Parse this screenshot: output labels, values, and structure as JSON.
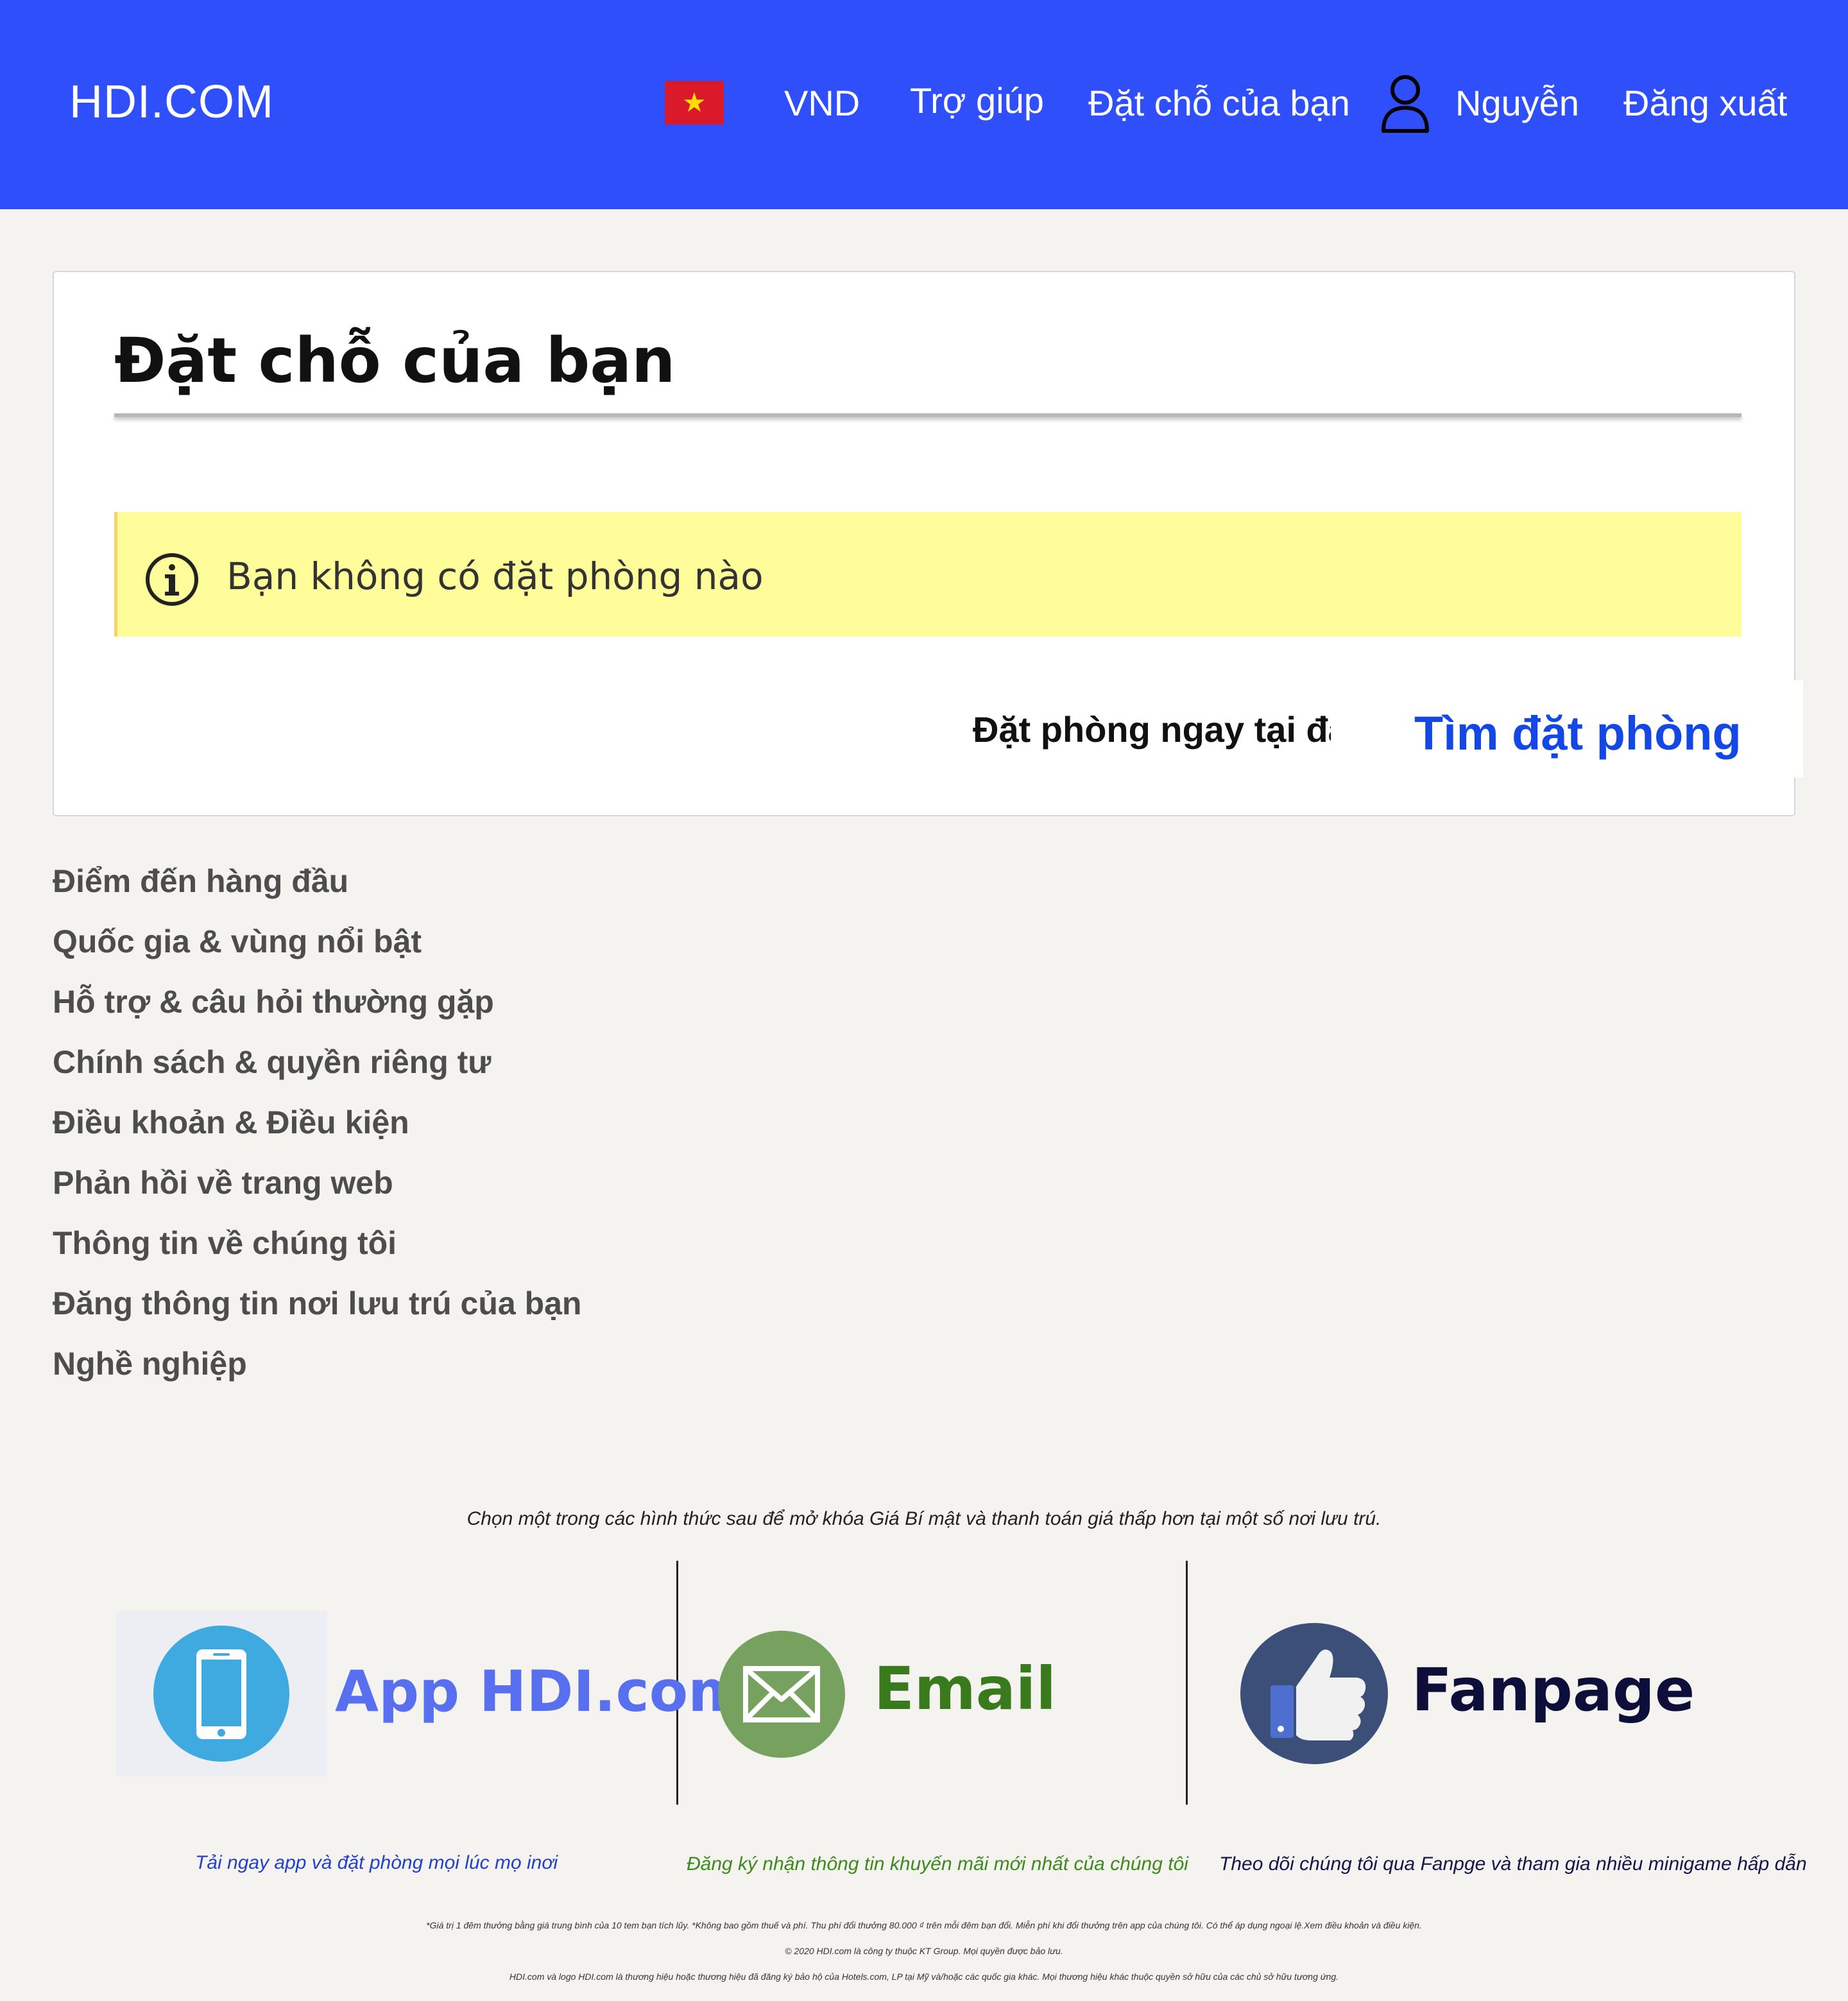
{
  "header": {
    "brand": "HDI.COM",
    "currency": "VND",
    "help": "Trợ giúp",
    "bookings": "Đặt chỗ của bạn",
    "user_name": "Nguyễn",
    "logout": "Đăng xuất"
  },
  "main": {
    "title": "Đặt chỗ của bạn",
    "alert": "Bạn không có đặt phòng nào",
    "book_now_label": "Đặt phòng ngay tại đây",
    "find_button": "Tìm đặt phòng"
  },
  "footer_links": [
    "Điểm đến hàng đầu",
    "Quốc gia & vùng nổi bật",
    "Hỗ trợ & câu hỏi thường gặp",
    "Chính sách & quyền riêng tư",
    "Điều khoản & Điều kiện",
    "Phản hồi về trang web",
    "Thông tin về chúng tôi",
    "Đăng thông tin nơi lưu trú của bạn",
    "Nghề nghiệp"
  ],
  "promo": {
    "intro": "Chọn một trong các hình thức sau để mở khóa Giá Bí mật và thanh toán giá thấp hơn tại một số nơi lưu trú.",
    "app": {
      "title": "App HDI.com",
      "desc": "Tải ngay app và đặt phòng mọi lúc mọ inơi",
      "icon": "phone-icon",
      "color": "#5870ef"
    },
    "email": {
      "title": "Email",
      "desc": "Đăng ký nhận thông tin khuyến mãi mới nhất của chúng tôi",
      "icon": "envelope-icon",
      "color": "#387a1c"
    },
    "fanpage": {
      "title": "Fanpage",
      "desc": "Theo dõi chúng tôi qua Fanpge và tham gia nhiều minigame hấp dẫn",
      "icon": "thumbs-up-icon",
      "color": "#0d0f3a"
    }
  },
  "fine_print": [
    "*Giá trị 1 đêm thưởng bằng giá trung bình của 10 tem bạn tích lũy. *Không bao gồm thuế và phí. Thu phí đổi thưởng 80.000 ₫ trên mỗi đêm bạn đổi. Miễn phí khi đổi thưởng trên app của chúng tôi. Có thể áp dụng ngoại lệ.Xem điều khoản và điều kiện.",
    "© 2020 HDI.com là công ty thuộc KT Group. Mọi quyền được bảo lưu.",
    "HDI.com và logo HDI.com là thương hiệu hoặc thương hiệu đã đăng ký bảo hộ của Hotels.com, LP tại Mỹ và/hoặc các quốc gia khác. Mọi thương hiệu khác thuộc quyền sở hữu của các chủ sở hữu tương ứng."
  ],
  "colors": {
    "header_bg": "#2f4ffb",
    "alert_bg": "#fefd99",
    "find_button_text": "#1448e6"
  }
}
